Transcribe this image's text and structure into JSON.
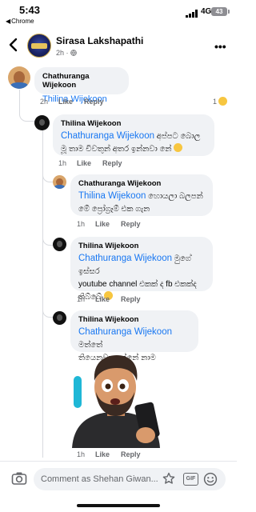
{
  "status": {
    "time": "5:43",
    "back_app": "Chrome",
    "network": "4G",
    "battery": "43"
  },
  "header": {
    "page_name": "Sirasa Lakshapathi",
    "post_age": "2h",
    "post_sep": "·"
  },
  "comments": [
    {
      "author": "Chathuranga Wijekoon",
      "mention": "Thilina Wijekoon",
      "text": "",
      "time": "2h",
      "like": "Like",
      "reply": "Reply",
      "reaction_count": "1"
    },
    {
      "author": "Thilina Wijekoon",
      "mention": "Chathuranga Wijekoon",
      "text": "අප්පට බොල මූ තාම චිවතුන් අතර ඉන්නවා නේ",
      "time": "1h",
      "like": "Like",
      "reply": "Reply"
    },
    {
      "author": "Chathuranga Wijekoon",
      "mention": "Thilina Wijekoon",
      "text": "හොයලා බලපන් මේ ප්‍රෝග්‍රෑම් එක ගැන",
      "time": "1h",
      "like": "Like",
      "reply": "Reply"
    },
    {
      "author": "Thilina Wijekoon",
      "mention": "Chathuranga Wijekoon",
      "text_line1": "මුගේ ඉස්සර",
      "text_line2": "youtube channel එකක් ද fb එකක්ද",
      "text_line3": "තිබ්බේ",
      "time": "1h",
      "like": "Like",
      "reply": "Reply"
    },
    {
      "author": "Thilina Wijekoon",
      "mention": "Chathuranga Wijekoon",
      "text_line1": "මත්තේ",
      "text_line2": "තියෙනවාද දන්නේ නාම",
      "time": "1h",
      "like": "Like",
      "reply": "Reply"
    }
  ],
  "composer": {
    "placeholder": "Comment as Shehan Giwan..."
  },
  "colors": {
    "mention": "#1877f2",
    "bubble": "#f0f2f5",
    "meta": "#65676b"
  },
  "icons": [
    "back-icon",
    "more-icon",
    "camera-icon",
    "sticker-icon",
    "gif-icon",
    "emoji-icon"
  ]
}
